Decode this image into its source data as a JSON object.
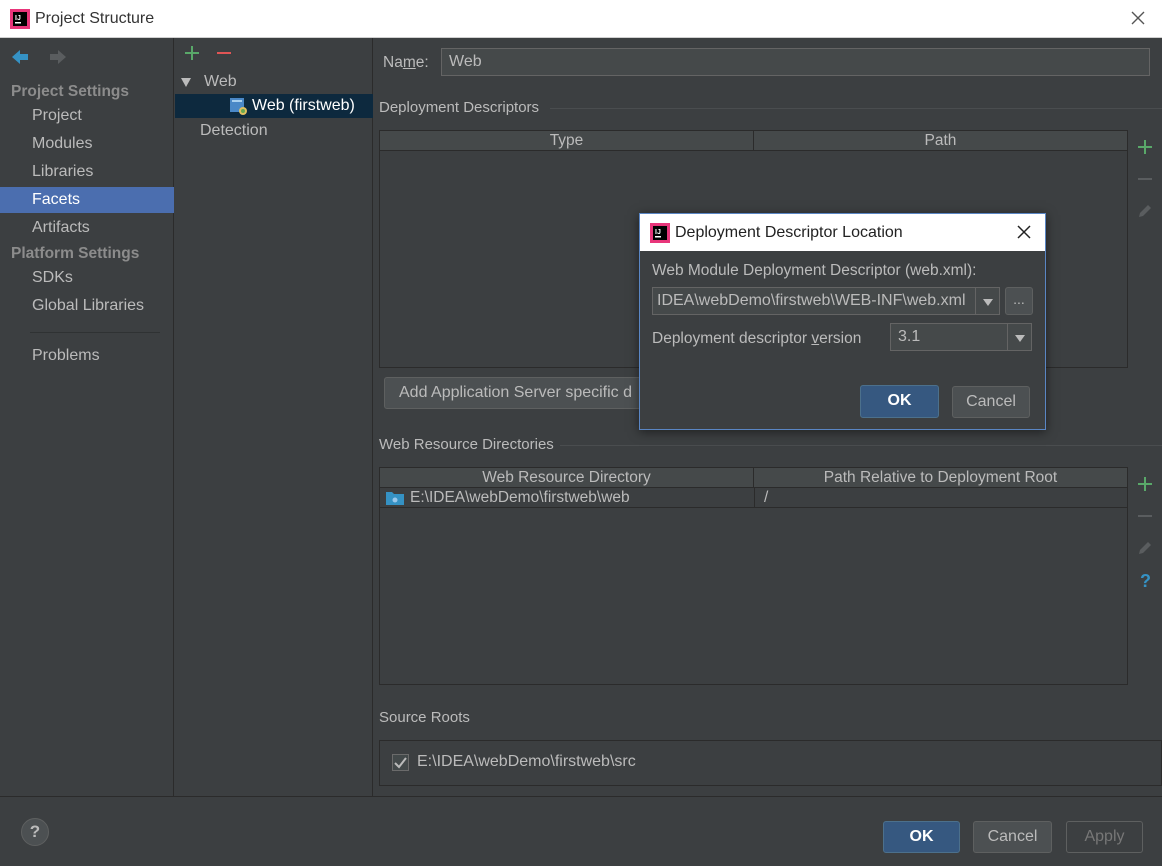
{
  "window": {
    "title": "Project Structure"
  },
  "sidebar": {
    "project_settings": "Project Settings",
    "items": [
      {
        "label": "Project"
      },
      {
        "label": "Modules"
      },
      {
        "label": "Libraries"
      },
      {
        "label": "Facets"
      },
      {
        "label": "Artifacts"
      }
    ],
    "platform_settings": "Platform Settings",
    "platform_items": [
      {
        "label": "SDKs"
      },
      {
        "label": "Global Libraries"
      }
    ],
    "problems": "Problems"
  },
  "tree": {
    "root": "Web",
    "child": "Web (firstweb)",
    "detection": "Detection"
  },
  "content": {
    "name_label_pre": "Na",
    "name_label_u": "m",
    "name_label_post": "e:",
    "name_value": "Web",
    "deployment_descriptors": "Deployment Descriptors",
    "dd_columns": [
      "Type",
      "Path"
    ],
    "add_server_button": "Add Application Server specific d",
    "web_resource_directories": "Web Resource Directories",
    "wrd_columns": [
      "Web Resource Directory",
      "Path Relative to Deployment Root"
    ],
    "wrd_rows": [
      {
        "directory": "E:\\IDEA\\webDemo\\firstweb\\web",
        "path": "/"
      }
    ],
    "source_roots": "Source Roots",
    "source_root_item": "E:\\IDEA\\webDemo\\firstweb\\src"
  },
  "footer": {
    "help": "?",
    "ok": "OK",
    "cancel": "Cancel",
    "apply": "Apply"
  },
  "modal": {
    "title": "Deployment Descriptor Location",
    "descriptor_label": "Web Module Deployment Descriptor (web.xml):",
    "descriptor_value": "IDEA\\webDemo\\firstweb\\WEB-INF\\web.xml",
    "browse": "...",
    "version_label_pre": "Deployment descriptor ",
    "version_label_u": "v",
    "version_label_post": "ersion",
    "version_value": "3.1",
    "ok": "OK",
    "cancel": "Cancel"
  },
  "colors": {
    "background": "#3c3f41",
    "selection": "#4b6eaf",
    "tree_selection": "#0d293e",
    "add_green": "#59a869",
    "remove_red": "#e05555",
    "accent_blue": "#3592c4"
  }
}
